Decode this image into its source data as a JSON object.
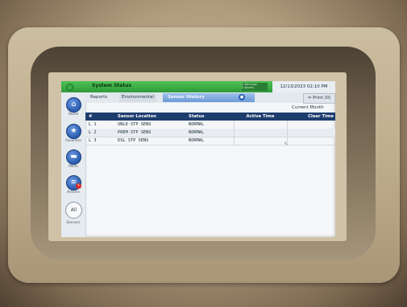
{
  "status_bar": {
    "title": "System Status",
    "alerts_line1": "0 Warnings",
    "alerts_line2": "0 Alarms",
    "datetime": "12/13/2023 02:10 PM",
    "color": "#3aa845"
  },
  "nav": {
    "items": [
      {
        "label": "Home",
        "icon": "home-icon"
      },
      {
        "label": "Favorites",
        "icon": "star-icon"
      },
      {
        "label": "Menu",
        "icon": "menu-icon"
      },
      {
        "label": "Actions",
        "icon": "actions-icon"
      },
      {
        "label": "Sensors",
        "button": "All"
      }
    ]
  },
  "tabs": {
    "reports": "Reports",
    "environmental": "Environmental",
    "sensor_history": "Sensor History",
    "print": "Print (0)"
  },
  "period": "Current Month",
  "table": {
    "headers": [
      "#",
      "Sensor Location",
      "Status",
      "Active Time",
      "Clear Time"
    ],
    "rows": [
      {
        "num": "L 1",
        "location": "UNLD STP SENS",
        "status": "NORMAL",
        "active": "",
        "clear": ""
      },
      {
        "num": "L 2",
        "location": "PREM STP SENS",
        "status": "NORMAL",
        "active": "",
        "clear": ""
      },
      {
        "num": "L 3",
        "location": "DSL STP SENS",
        "status": "NORMAL",
        "active": "",
        "clear": ""
      }
    ]
  }
}
